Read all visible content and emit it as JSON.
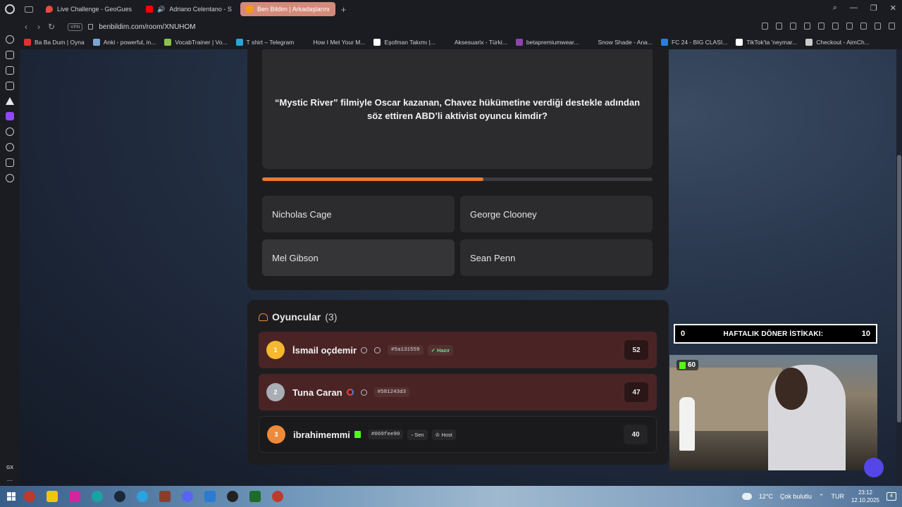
{
  "browser": {
    "tabs": [
      {
        "label": "Live Challenge - GeoGues",
        "color": "#e74c3c"
      },
      {
        "label": "Adriano Celentano - S",
        "color": "#ff0000"
      },
      {
        "label": "Ben Bildim | Arkadaşlarını",
        "color": "#f39c12"
      }
    ],
    "new_tab": "+",
    "vpn": "VPN",
    "url": "benbildim.com/room/XNUHOM",
    "bookmarks": [
      {
        "label": "Ba Ba Dum | Oyna",
        "color": "#e03131"
      },
      {
        "label": "Anki - powerful, in...",
        "color": "#7aa7d6"
      },
      {
        "label": "VocabTrainer | Vo...",
        "color": "#8bc34a"
      },
      {
        "label": "T shirt – Telegram",
        "color": "#2aa3df"
      },
      {
        "label": "How I Met Your M...",
        "color": "#1b1c21"
      },
      {
        "label": "Eşofman Takımı |...",
        "color": "#ffffff"
      },
      {
        "label": "Aksesuarix - Türki...",
        "color": "#1b1c21"
      },
      {
        "label": "betapremiumwear...",
        "color": "#8e44ad"
      },
      {
        "label": "Snow Shade - Ana...",
        "color": "#1b1c21"
      },
      {
        "label": "FC 24 - BIG CLASI...",
        "color": "#2c7be5"
      },
      {
        "label": "TikTok'ta 'neymar...",
        "color": "#ffffff"
      },
      {
        "label": "Checkout - AimCh...",
        "color": "#cccccc"
      }
    ],
    "side_extra": {
      "gx": "GX",
      "more": "..."
    }
  },
  "quiz": {
    "question": "“Mystic River” filmiyle Oscar kazanan, Chavez hükümetine verdiği destekle adından söz ettiren ABD’li aktivist oyuncu kimdir?",
    "progress": 0.566,
    "answers": [
      "Nicholas Cage",
      "George Clooney",
      "Mel Gibson",
      "Sean Penn"
    ]
  },
  "players": {
    "title": "Oyuncular",
    "count": "(3)",
    "list": [
      {
        "rank": "1",
        "name": "İsmail oçdemir",
        "id": "#5a131559",
        "badge": "Hazır",
        "score": "52",
        "rank_color": "#f5b82e"
      },
      {
        "rank": "2",
        "name": "Tuna Caran",
        "id": "#581243d3",
        "score": "47",
        "rank_color": "#a9adb5"
      },
      {
        "rank": "3",
        "name": "ibrahimemmi",
        "id": "#069fee90",
        "you": "Sen",
        "host": "Host",
        "score": "40",
        "rank_color": "#ee8a3a"
      }
    ]
  },
  "overlay": {
    "weekly_left": "0",
    "weekly_title": "HAFTALIK DÖNER İSTİKAKI:",
    "weekly_right": "10",
    "kick_viewers": "60"
  },
  "taskbar": {
    "temp": "12°C",
    "weather": "Çok bulutlu",
    "lang": "TUR",
    "time": "23:12",
    "date": "12.10.2025",
    "notifications": "4"
  }
}
